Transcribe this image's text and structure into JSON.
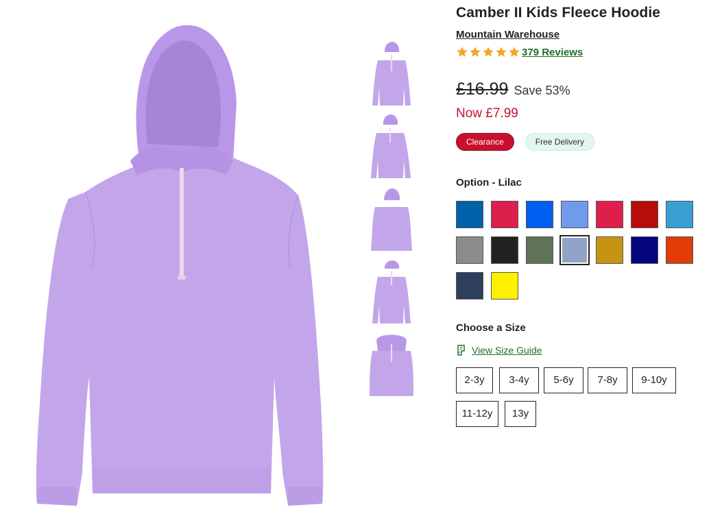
{
  "product": {
    "title": "Camber II Kids Fleece Hoodie",
    "brand": "Mountain Warehouse",
    "rating_stars": 5,
    "reviews_label": "379 Reviews",
    "colour_main": "#c3a6ea",
    "colour_shade": "#ab8bd9",
    "colour_light": "#d4bdf2"
  },
  "pricing": {
    "was_price": "£16.99",
    "save_label": "Save 53%",
    "now_price": "Now £7.99"
  },
  "badges": {
    "clearance": "Clearance",
    "delivery": "Free Delivery"
  },
  "option": {
    "label": "Option - Lilac",
    "swatches": [
      {
        "color": "#0060a8",
        "name": "swatch-blue"
      },
      {
        "color": "#dc1f4d",
        "name": "swatch-raspberry"
      },
      {
        "color": "#005ff0",
        "name": "swatch-bright-blue"
      },
      {
        "color": "#6e9bea",
        "name": "swatch-light-blue"
      },
      {
        "color": "#de1f4c",
        "name": "swatch-pink-red"
      },
      {
        "color": "#b80c0c",
        "name": "swatch-red"
      },
      {
        "color": "#38a0d1",
        "name": "swatch-cyan"
      },
      {
        "color": "#8c8c8c",
        "name": "swatch-grey"
      },
      {
        "color": "#222222",
        "name": "swatch-black"
      },
      {
        "color": "#5e7359",
        "name": "swatch-khaki"
      },
      {
        "color": "#92a3c8",
        "name": "swatch-lilac",
        "selected": true
      },
      {
        "color": "#c69313",
        "name": "swatch-mustard"
      },
      {
        "color": "#03067f",
        "name": "swatch-navy"
      },
      {
        "color": "#e23d06",
        "name": "swatch-orange"
      },
      {
        "color": "#2e3f5b",
        "name": "swatch-dark-navy"
      },
      {
        "color": "#fff000",
        "name": "swatch-yellow"
      }
    ]
  },
  "size": {
    "label": "Choose a Size",
    "guide_label": "View Size Guide",
    "options": [
      "2-3y",
      "3-4y",
      "5-6y",
      "7-8y",
      "9-10y",
      "11-12y",
      "13y"
    ]
  },
  "icons": {
    "star": "star-icon",
    "size_guide": "ruler-icon",
    "star_color": "#f5a623"
  }
}
